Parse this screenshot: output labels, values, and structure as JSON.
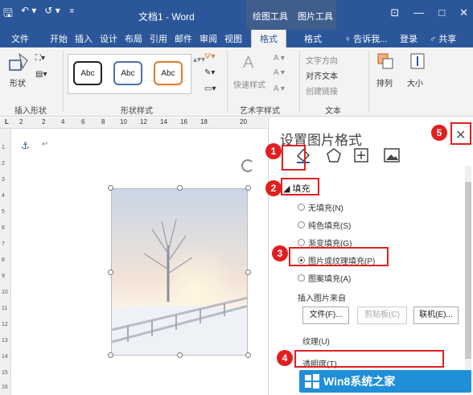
{
  "titlebar": {
    "qat_save": "🖫",
    "qat_undo": "↶ ▾",
    "qat_redo": "↺ ▾",
    "qat_more": "⌅",
    "doc_title": "文档1 - Word",
    "ctx_drawing_tools": "绘图工具",
    "ctx_picture_tools": "图片工具",
    "win_ribbon_opts": "⊡",
    "win_minimize": "—",
    "win_maximize": "□",
    "win_close": "✕"
  },
  "tabs": {
    "items": [
      "文件",
      "开始",
      "插入",
      "设计",
      "布局",
      "引用",
      "邮件",
      "审阅",
      "视图"
    ],
    "active_format": "格式",
    "format2": "格式",
    "tell_me": "♀ 告诉我...",
    "login": "登录",
    "share": "♂ 共享"
  },
  "ribbon": {
    "shapes_btn": "形状",
    "insert_shapes_label": "插入形状",
    "style_abc": [
      "Abc",
      "Abc",
      "Abc"
    ],
    "shape_styles_label": "形状样式",
    "quick_styles": "快速样式",
    "wordart_label": "艺术字样式",
    "text_direction": "文字方向",
    "align_text": "对齐文本",
    "create_link": "创建链接",
    "text_label": "文本",
    "arrange": "排列",
    "size": "大小"
  },
  "ruler": {
    "ticks": [
      "2",
      "2",
      "4",
      "6",
      "8",
      "10",
      "12",
      "14",
      "16",
      "18",
      "20"
    ],
    "vticks": [
      "1",
      "2",
      "3",
      "4",
      "5",
      "6",
      "7",
      "8",
      "9",
      "10",
      "11",
      "12",
      "13",
      "14",
      "15",
      "16"
    ]
  },
  "pane": {
    "title": "设置图片格式",
    "fill_section": "◢ 填充",
    "options": [
      "无填充(N)",
      "纯色填充(S)",
      "渐变填充(G)",
      "图片或纹理填充(P)",
      "图案填充(A)"
    ],
    "selected_option": 3,
    "insert_from": "插入图片来自",
    "btn_file": "文件(F)...",
    "btn_clipboard": "剪贴板(C)",
    "btn_online": "联机(E)...",
    "texture": "纹理(U)",
    "transparency": "透明度(T)"
  },
  "callouts": [
    "1",
    "2",
    "3",
    "4",
    "5"
  ],
  "watermark": "Win8系统之家",
  "colors": {
    "accent": "#2b579a",
    "callout_red": "#e02020",
    "watermark_blue": "#1f8fd8"
  }
}
